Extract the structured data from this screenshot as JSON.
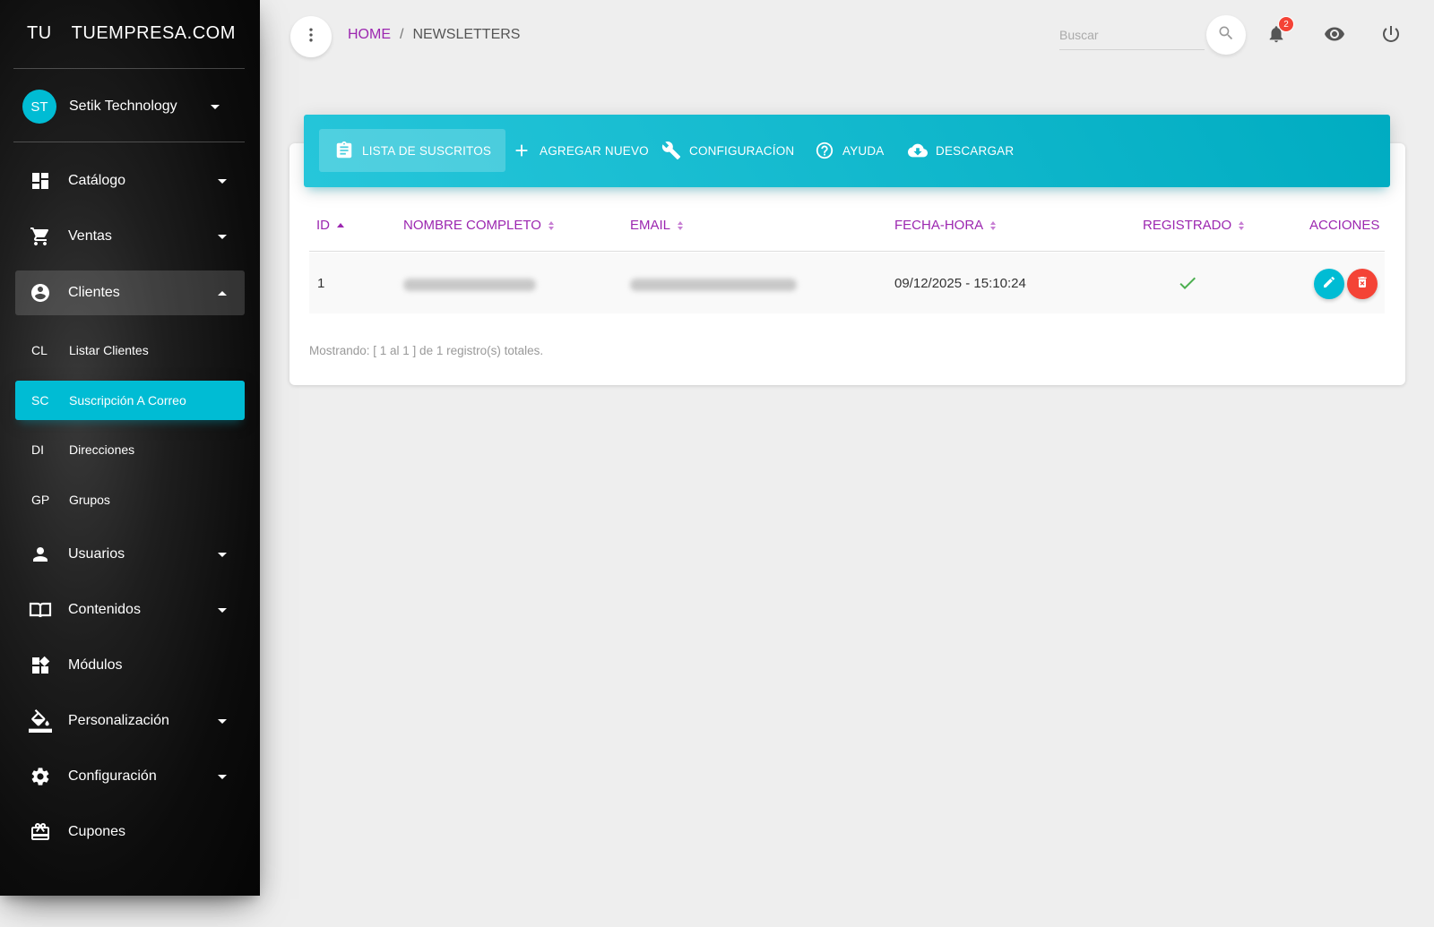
{
  "brand": {
    "short": "TU",
    "name": "TUEMPRESA.COM"
  },
  "user": {
    "initials": "ST",
    "name": "Setik Technology"
  },
  "sidebar": {
    "items": [
      {
        "label": "Catálogo"
      },
      {
        "label": "Ventas"
      },
      {
        "label": "Clientes"
      },
      {
        "label": "Usuarios"
      },
      {
        "label": "Contenidos"
      },
      {
        "label": "Módulos"
      },
      {
        "label": "Personalización"
      },
      {
        "label": "Configuración"
      },
      {
        "label": "Cupones"
      }
    ],
    "subitems": [
      {
        "abbr": "CL",
        "label": "Listar Clientes"
      },
      {
        "abbr": "SC",
        "label": "Suscripción A Correo"
      },
      {
        "abbr": "DI",
        "label": "Direcciones"
      },
      {
        "abbr": "GP",
        "label": "Grupos"
      }
    ]
  },
  "breadcrumb": {
    "home": "HOME",
    "separator": "/",
    "current": "NEWSLETTERS"
  },
  "search": {
    "placeholder": "Buscar"
  },
  "notifications": {
    "count": "2"
  },
  "tabs": [
    {
      "label": "LISTA DE SUSCRITOS"
    },
    {
      "label": "AGREGAR NUEVO"
    },
    {
      "label": "CONFIGURACÍON"
    },
    {
      "label": "AYUDA"
    },
    {
      "label": "DESCARGAR"
    }
  ],
  "table": {
    "columns": [
      "ID",
      "NOMBRE COMPLETO",
      "EMAIL",
      "FECHA-HORA",
      "REGISTRADO",
      "ACCIONES"
    ],
    "rows": [
      {
        "id": "1",
        "datetime": "09/12/2025 - 15:10:24"
      }
    ]
  },
  "footer": {
    "summary": "Mostrando: [ 1 al 1 ] de 1 registro(s) totales."
  },
  "colors": {
    "accent": "#00bcd4",
    "primary": "#9c27b0",
    "danger": "#f44336",
    "success": "#4caf50"
  }
}
